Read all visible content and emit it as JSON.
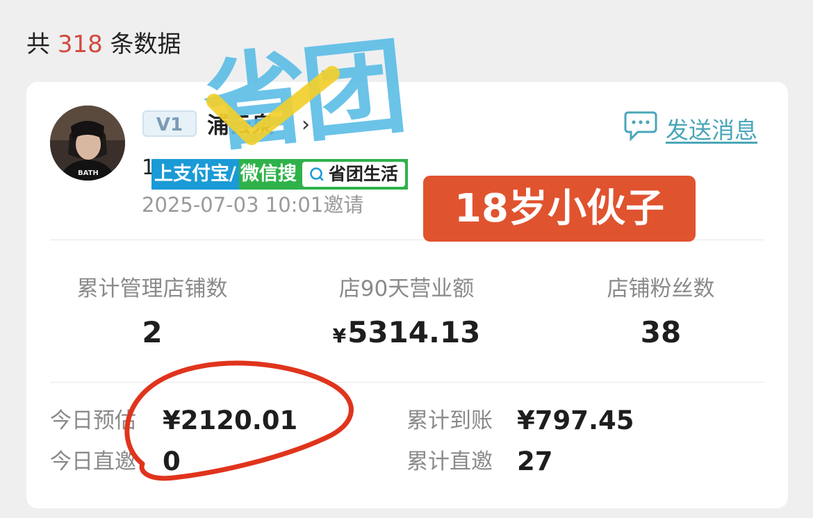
{
  "summary": {
    "prefix": "共",
    "count": "318",
    "suffix": "条数据"
  },
  "user": {
    "level": "V1",
    "nickname": "浦云泉",
    "id_partial": "1",
    "invite_time": "2025-07-03 10:01邀请"
  },
  "actions": {
    "send_message": "发送消息"
  },
  "stats": [
    {
      "label": "累计管理店铺数",
      "value": "2"
    },
    {
      "label": "店90天营业额",
      "currency": "¥",
      "value": "5314.13"
    },
    {
      "label": "店铺粉丝数",
      "value": "38"
    }
  ],
  "earnings": {
    "today_estimate_label": "今日预估",
    "today_estimate_value": "¥2120.01",
    "total_received_label": "累计到账",
    "total_received_value": "¥797.45",
    "today_direct_label": "今日直邀",
    "today_direct_value": "0",
    "total_direct_label": "累计直邀",
    "total_direct_value": "27"
  },
  "overlay": {
    "promo_seg1": "上支付宝/",
    "promo_seg2": "微信搜",
    "promo_search": "省团生活",
    "age_text": "18岁小伙子",
    "watermark_text": "省团"
  },
  "colors": {
    "count_red": "#d14b3e",
    "link_teal": "#4aa6b8",
    "sticker_orange": "#e0532f",
    "annotation_red": "#e0341c",
    "watermark_blue": "#5bbde6",
    "check_yellow": "#f2cf2c"
  }
}
